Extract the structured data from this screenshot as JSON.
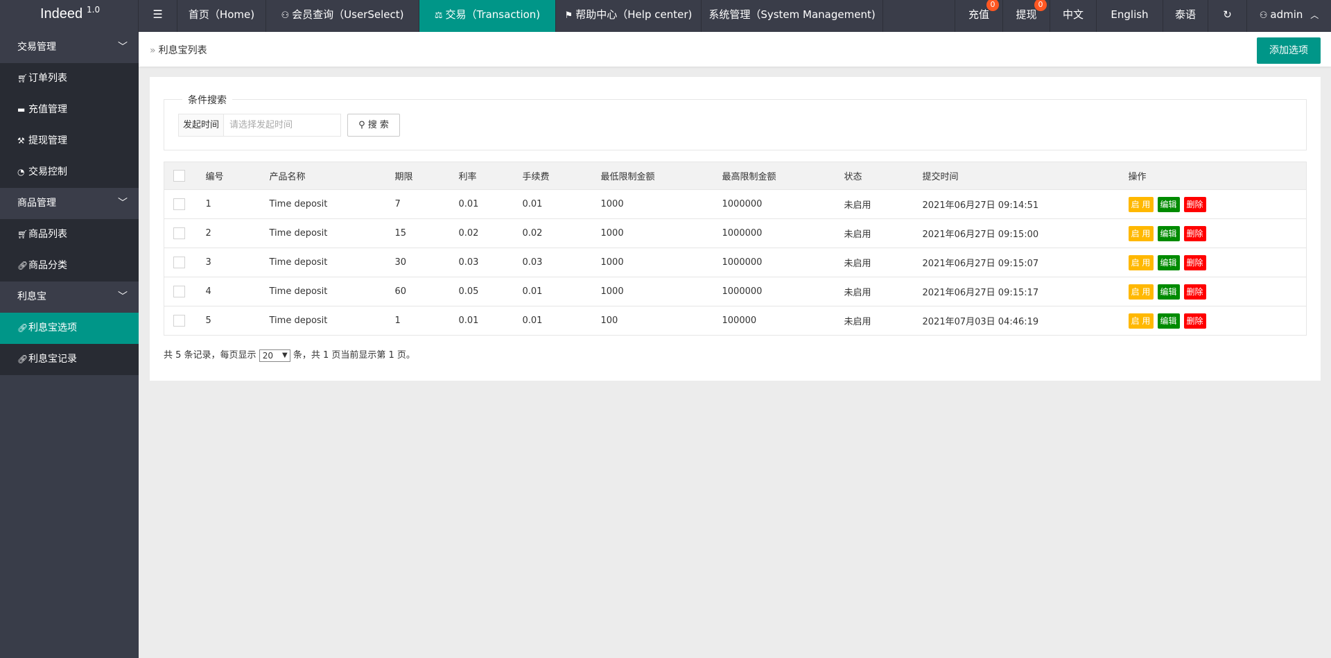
{
  "brand": {
    "name": "Indeed",
    "version": "1.0"
  },
  "topnav": {
    "menu_icon": "menu-icon",
    "items": [
      {
        "label": "首页（Home)"
      },
      {
        "label": "会员查询（UserSelect)"
      },
      {
        "label": "交易（Transaction)"
      },
      {
        "label": "帮助中心（Help center)"
      },
      {
        "label": "系统管理（System Management)"
      }
    ],
    "recharge": {
      "label": "充值",
      "count": "0"
    },
    "withdraw": {
      "label": "提现",
      "count": "0"
    },
    "lang_zh": "中文",
    "lang_en": "English",
    "lang_th": "泰语",
    "user": "admin"
  },
  "sidebar": {
    "groups": [
      {
        "label": "交易管理",
        "items": [
          {
            "label": "订单列表"
          },
          {
            "label": "充值管理"
          },
          {
            "label": "提现管理"
          },
          {
            "label": "交易控制"
          }
        ]
      },
      {
        "label": "商品管理",
        "items": [
          {
            "label": "商品列表"
          },
          {
            "label": "商品分类"
          }
        ]
      },
      {
        "label": "利息宝",
        "items": [
          {
            "label": "利息宝选项"
          },
          {
            "label": "利息宝记录"
          }
        ]
      }
    ]
  },
  "breadcrumb": {
    "label": "利息宝列表"
  },
  "add_button": "添加选项",
  "search": {
    "legend": "条件搜索",
    "field_label": "发起时间",
    "placeholder": "请选择发起时间",
    "button": "搜 索"
  },
  "table": {
    "headers": [
      "编号",
      "产品名称",
      "期限",
      "利率",
      "手续费",
      "最低限制金额",
      "最高限制金额",
      "状态",
      "提交时间",
      "操作"
    ],
    "rows": [
      {
        "id": "1",
        "name": "Time deposit",
        "term": "7",
        "rate": "0.01",
        "fee": "0.01",
        "min": "1000",
        "max": "1000000",
        "status": "未启用",
        "time": "2021年06月27日 09:14:51"
      },
      {
        "id": "2",
        "name": "Time deposit",
        "term": "15",
        "rate": "0.02",
        "fee": "0.02",
        "min": "1000",
        "max": "1000000",
        "status": "未启用",
        "time": "2021年06月27日 09:15:00"
      },
      {
        "id": "3",
        "name": "Time deposit",
        "term": "30",
        "rate": "0.03",
        "fee": "0.03",
        "min": "1000",
        "max": "1000000",
        "status": "未启用",
        "time": "2021年06月27日 09:15:07"
      },
      {
        "id": "4",
        "name": "Time deposit",
        "term": "60",
        "rate": "0.05",
        "fee": "0.01",
        "min": "1000",
        "max": "1000000",
        "status": "未启用",
        "time": "2021年06月27日 09:15:17"
      },
      {
        "id": "5",
        "name": "Time deposit",
        "term": "1",
        "rate": "0.01",
        "fee": "0.01",
        "min": "100",
        "max": "100000",
        "status": "未启用",
        "time": "2021年07月03日 04:46:19"
      }
    ],
    "actions": {
      "enable": "启 用",
      "edit": "编辑",
      "delete": "删除"
    }
  },
  "pager": {
    "prefix": "共 5 条记录，每页显示",
    "page_size": "20",
    "suffix": "条，共 1 页当前显示第 1 页。"
  },
  "colors": {
    "accent": "#009688",
    "header": "#3a3d49",
    "warn": "#ffb800",
    "ok": "#008b00",
    "danger": "#ff0000"
  }
}
